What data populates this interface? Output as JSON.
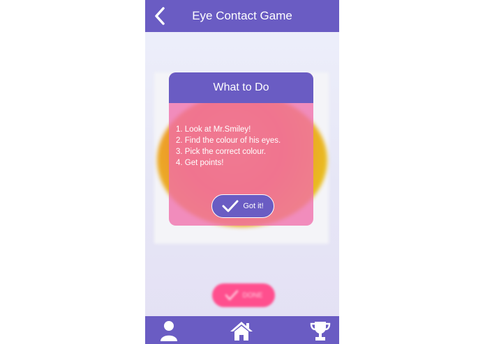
{
  "header": {
    "title": "Eye Contact Game",
    "back_icon": "chevron-left-icon"
  },
  "dialog": {
    "title": "What to Do",
    "steps": [
      "1. Look at Mr.Smiley!",
      "2. Find the colour of his eyes.",
      "3. Pick the correct colour.",
      "4. Get points!"
    ],
    "got_it_label": "Got it!"
  },
  "done_label": "DONE",
  "bottom_nav": [
    "profile-icon",
    "home-icon",
    "trophy-icon"
  ],
  "colors": {
    "accent": "#6a5cc3",
    "done_pink": "#ff4f8e",
    "dialog_body": "#f06eaa"
  }
}
